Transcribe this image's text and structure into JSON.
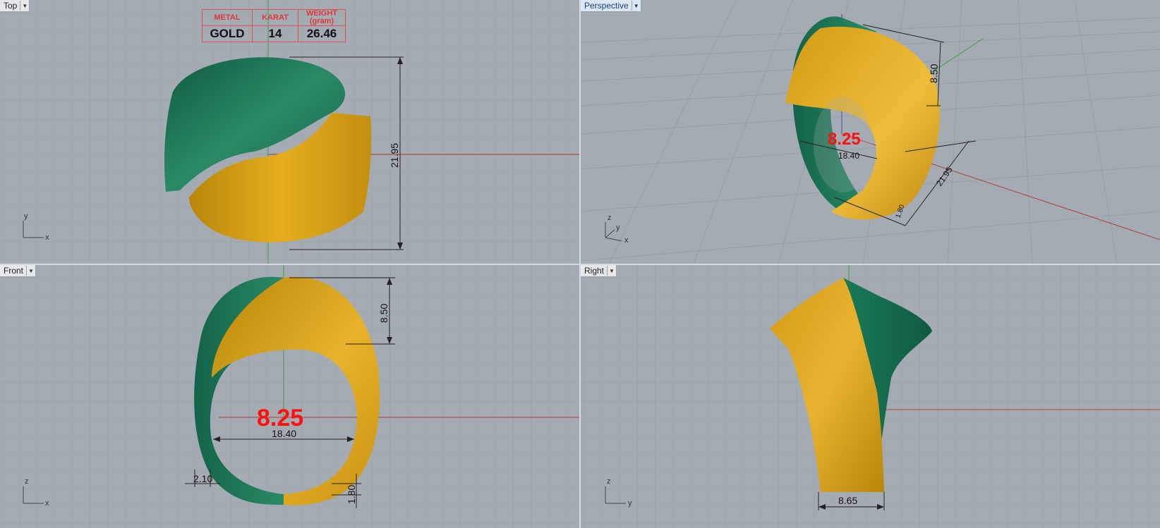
{
  "viewports": {
    "top": {
      "label": "Top"
    },
    "perspective": {
      "label": "Perspective"
    },
    "front": {
      "label": "Front"
    },
    "right": {
      "label": "Right"
    }
  },
  "info_table": {
    "headers": [
      "METAL",
      "KARAT",
      "WEIGHT"
    ],
    "weight_unit": "(gram)",
    "values": [
      "GOLD",
      "14",
      "26.46"
    ]
  },
  "dimensions": {
    "top_height": "21.95",
    "persp_height": "8.50",
    "persp_size": "8.25",
    "persp_inner": "18.40",
    "persp_depth": "21.95",
    "persp_thick": "1.80",
    "front_height": "8.50",
    "ring_size": "8.25",
    "inner_diameter": "18.40",
    "side_thickness": "2.10",
    "bottom_thickness": "1.80",
    "right_width": "8.65"
  },
  "axes": {
    "top": [
      "y",
      "x"
    ],
    "perspective": [
      "z",
      "y",
      "x"
    ],
    "front": [
      "z",
      "x"
    ],
    "right": [
      "z",
      "y"
    ]
  },
  "colors": {
    "viewport_bg": "#a5abb3",
    "gold": "#d9a21c",
    "green": "#1d7a5a",
    "x_axis": "#b04040",
    "y_axis": "#3aa03a"
  }
}
